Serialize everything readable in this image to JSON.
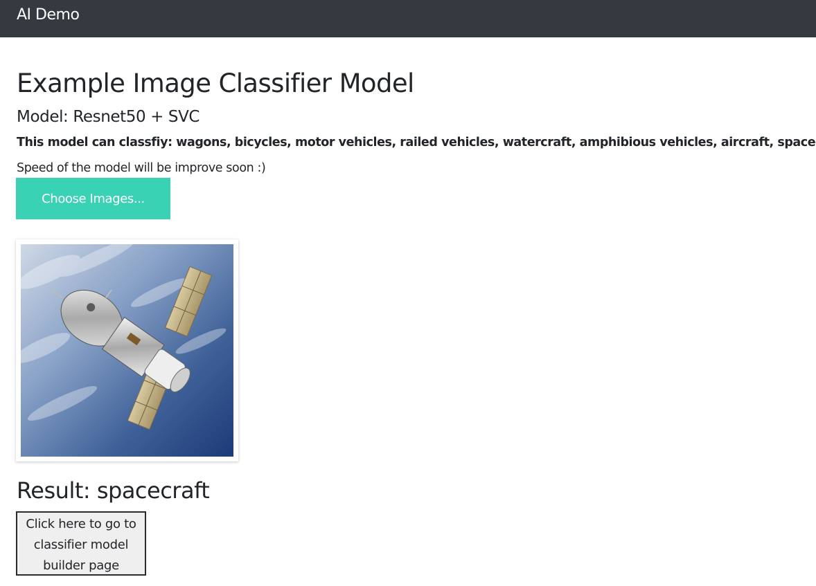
{
  "navbar": {
    "brand": "AI Demo"
  },
  "main": {
    "title": "Example Image Classifier Model",
    "model_line": "Model: Resnet50 + SVC",
    "classes_line": "This model can classfiy: wagons, bicycles, motor vehicles, railed vehicles, watercraft, amphibious vehicles, aircraft, spacecraft.",
    "speed_note": "Speed of the model will be improve soon :)",
    "choose_button_label": "Choose Images...",
    "result_text": "Result: spacecraft",
    "builder_button_label": "Click here to go to classifier model builder page"
  },
  "colors": {
    "navbar_bg": "#343a40",
    "accent_button": "#3ad2b4",
    "text": "#212529"
  },
  "icons": {
    "uploaded_image": "spacecraft-photo"
  }
}
